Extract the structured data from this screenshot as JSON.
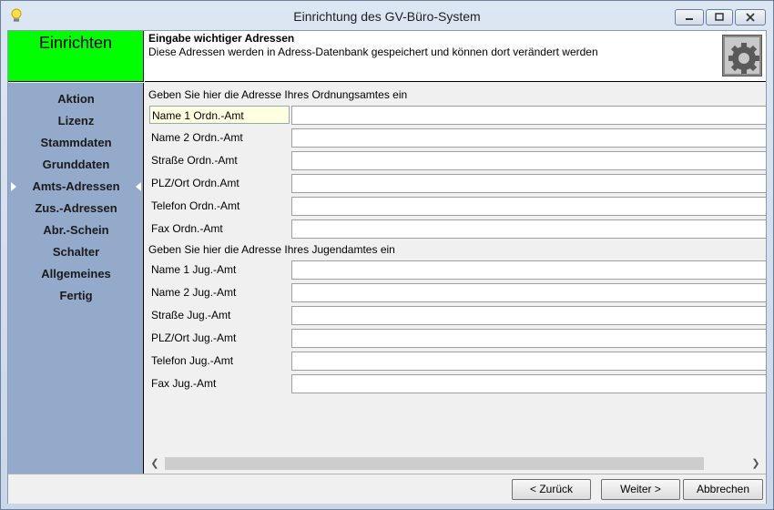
{
  "window": {
    "title": "Einrichtung des GV-Büro-System"
  },
  "panel": {
    "label": "Einrichten"
  },
  "header": {
    "title": "Eingabe wichtiger Adressen",
    "subtitle": "Diese Adressen werden in Adress-Datenbank gespeichert und können dort verändert werden"
  },
  "sidebar": {
    "items": [
      {
        "label": "Aktion"
      },
      {
        "label": "Lizenz"
      },
      {
        "label": "Stammdaten"
      },
      {
        "label": "Grunddaten"
      },
      {
        "label": "Amts-Adressen",
        "selected": true
      },
      {
        "label": "Zus.-Adressen"
      },
      {
        "label": "Abr.-Schein"
      },
      {
        "label": "Schalter"
      },
      {
        "label": "Allgemeines"
      },
      {
        "label": "Fertig"
      }
    ]
  },
  "ordnungsamt": {
    "heading": "Geben Sie hier die Adresse Ihres Ordnungsamtes ein",
    "fields": [
      {
        "label": "Name 1 Ordn.-Amt",
        "value": ""
      },
      {
        "label": "Name 2 Ordn.-Amt",
        "value": ""
      },
      {
        "label": "Straße Ordn.-Amt",
        "value": ""
      },
      {
        "label": "PLZ/Ort Ordn.Amt",
        "value": ""
      },
      {
        "label": "Telefon Ordn.-Amt",
        "value": ""
      },
      {
        "label": "Fax Ordn.-Amt",
        "value": ""
      }
    ]
  },
  "jugendamt": {
    "heading": "Geben Sie hier die Adresse Ihres Jugendamtes ein",
    "fields": [
      {
        "label": "Name 1 Jug.-Amt",
        "value": ""
      },
      {
        "label": "Name 2 Jug.-Amt",
        "value": ""
      },
      {
        "label": "Straße Jug.-Amt",
        "value": ""
      },
      {
        "label": "PLZ/Ort Jug.-Amt",
        "value": ""
      },
      {
        "label": "Telefon Jug.-Amt",
        "value": ""
      },
      {
        "label": "Fax Jug.-Amt",
        "value": ""
      }
    ]
  },
  "footer": {
    "back_label": "< Zurück",
    "next_label": "Weiter >",
    "cancel_label": "Abbrechen"
  },
  "colors": {
    "panel_green": "#00ff00",
    "sidebar_blue": "#94aacb"
  }
}
